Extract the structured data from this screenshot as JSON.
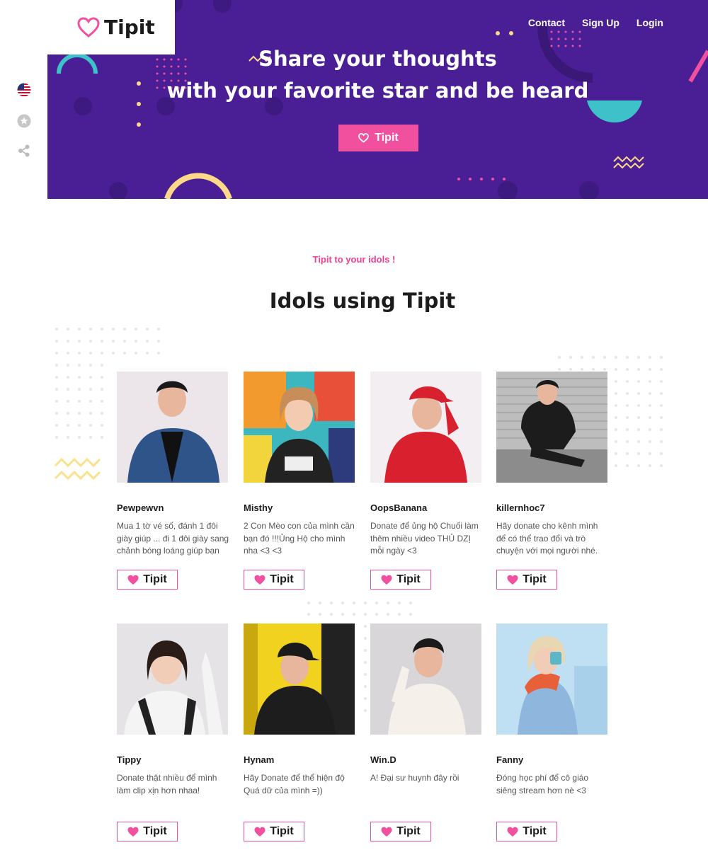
{
  "brand": {
    "name": "Tipit",
    "accent": "#f0509e",
    "hero_bg": "#4a1f96"
  },
  "nav": {
    "contact": "Contact",
    "signup": "Sign Up",
    "login": "Login"
  },
  "side_icons": [
    "us-flag-icon",
    "star-icon",
    "share-icon"
  ],
  "hero": {
    "line1": "Share your thoughts",
    "line2": "with your favorite star and be heard",
    "button_label": "Tipit"
  },
  "section": {
    "tagline": "Tipit to your idols !",
    "title": "Idols using Tipit"
  },
  "idols": [
    {
      "name": "Pewpewvn",
      "desc": "Mua 1 tờ vé số, đánh 1 đôi giày giúp ... đi 1 đôi giày sang chảnh bóng loáng giúp bạn",
      "button": "Tipit"
    },
    {
      "name": "Misthy",
      "desc": "2 Con Mèo con của mình cần bạn đó !!!Ủng Hộ cho mình nha <3 <3",
      "button": "Tipit"
    },
    {
      "name": "OopsBanana",
      "desc": "Donate để ủng hộ Chuối làm thêm nhiều video THỦ DZỊ mỗi ngày <3",
      "button": "Tipit"
    },
    {
      "name": "killernhoc7",
      "desc": "Hãy donate cho kênh mình để có thể trao đổi và trò chuyện với mọi người nhé.",
      "button": "Tipit"
    },
    {
      "name": "Tippy",
      "desc": "Donate thật nhiều để mình làm clip xịn hơn nhaa!",
      "button": "Tipit"
    },
    {
      "name": "Hynam",
      "desc": "Hãy Donate để thể hiện độ Quá dữ của mình =))",
      "button": "Tipit"
    },
    {
      "name": "Win.D",
      "desc": "A! Đại sư huynh đây rồi",
      "button": "Tipit"
    },
    {
      "name": "Fanny",
      "desc": "Đóng học phí để cô giáo siêng stream hơn nè <3",
      "button": "Tipit"
    }
  ]
}
